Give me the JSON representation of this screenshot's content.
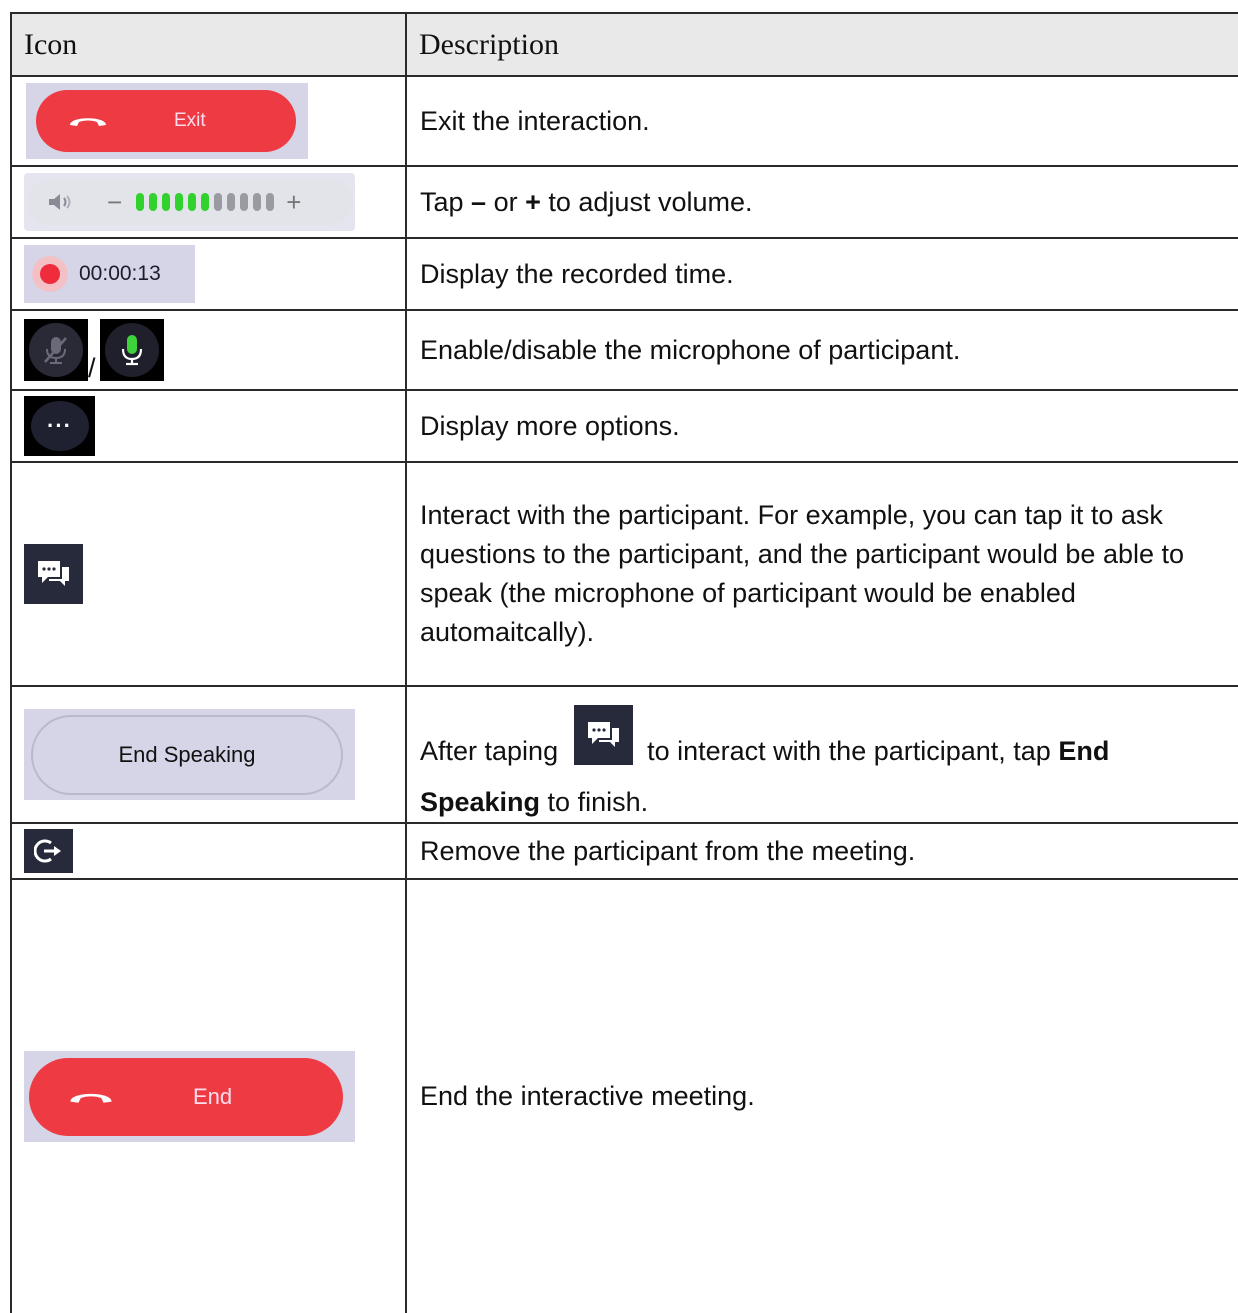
{
  "header": {
    "col_icon": "Icon",
    "col_description": "Description"
  },
  "rows": [
    {
      "icon_label": "Exit",
      "description": "Exit the interaction."
    },
    {
      "desc_prefix": "Tap ",
      "desc_minus": "–",
      "desc_mid": " or ",
      "desc_plus": "+",
      "desc_suffix": " to adjust volume.",
      "active_bars": 6,
      "total_bars": 11
    },
    {
      "icon_label": "00:00:13",
      "description": "Display the recorded time."
    },
    {
      "separator": "/",
      "description": "Enable/disable the microphone of participant."
    },
    {
      "icon_label": "···",
      "description": "Display more options."
    },
    {
      "description": "Interact with the participant. For example, you can tap it to ask questions to the participant, and the participant would be able to speak (the microphone of participant would be enabled automaitcally)."
    },
    {
      "icon_label": "End Speaking",
      "desc_prefix": "After taping",
      "desc_mid": "to interact with the participant, tap ",
      "desc_bold": "End Speaking",
      "desc_suffix": " to finish."
    },
    {
      "description": "Remove the participant from the meeting."
    },
    {
      "icon_label": "End",
      "description": "End the interactive meeting."
    }
  ],
  "colors": {
    "red": "#ee3b43",
    "green": "#31d12e",
    "icon_bg": "#272a3b",
    "screenshot_bg": "#d6d5e8"
  }
}
